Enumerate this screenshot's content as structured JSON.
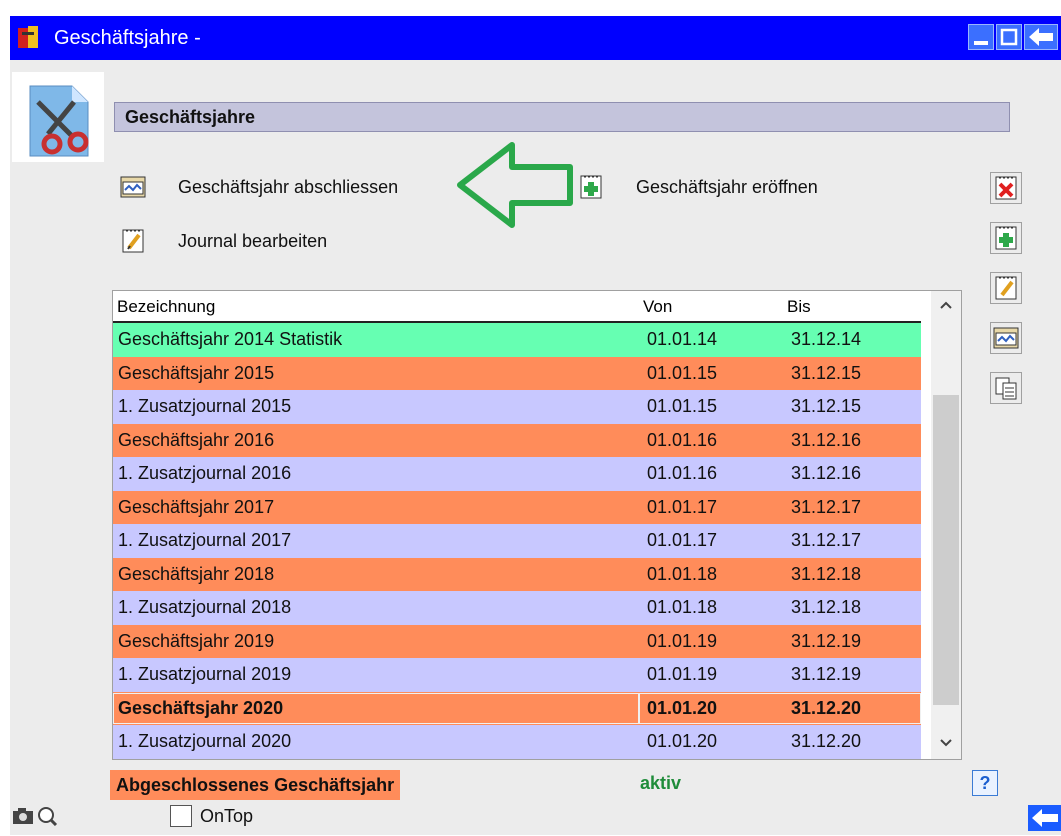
{
  "window": {
    "title": "Geschäftsjahre -"
  },
  "header": {
    "section_title": "Geschäftsjahre"
  },
  "actions": {
    "close_year": "Geschäftsjahr abschliessen",
    "open_year": "Geschäftsjahr eröffnen",
    "edit_journal": "Journal bearbeiten"
  },
  "table": {
    "columns": [
      "Bezeichnung",
      "Von",
      "Bis"
    ],
    "rows": [
      {
        "name": "Geschäftsjahr 2014 Statistik",
        "von": "01.01.14",
        "bis": "31.12.14",
        "status": "statistik"
      },
      {
        "name": "Geschäftsjahr 2015",
        "von": "01.01.15",
        "bis": "31.12.15",
        "status": "closed"
      },
      {
        "name": "1. Zusatzjournal 2015",
        "von": "01.01.15",
        "bis": "31.12.15",
        "status": "journal"
      },
      {
        "name": "Geschäftsjahr 2016",
        "von": "01.01.16",
        "bis": "31.12.16",
        "status": "closed"
      },
      {
        "name": "1. Zusatzjournal 2016",
        "von": "01.01.16",
        "bis": "31.12.16",
        "status": "journal"
      },
      {
        "name": "Geschäftsjahr 2017",
        "von": "01.01.17",
        "bis": "31.12.17",
        "status": "closed"
      },
      {
        "name": "1. Zusatzjournal 2017",
        "von": "01.01.17",
        "bis": "31.12.17",
        "status": "journal"
      },
      {
        "name": "Geschäftsjahr 2018",
        "von": "01.01.18",
        "bis": "31.12.18",
        "status": "closed"
      },
      {
        "name": "1. Zusatzjournal 2018",
        "von": "01.01.18",
        "bis": "31.12.18",
        "status": "journal"
      },
      {
        "name": "Geschäftsjahr 2019",
        "von": "01.01.19",
        "bis": "31.12.19",
        "status": "closed"
      },
      {
        "name": "1. Zusatzjournal 2019",
        "von": "01.01.19",
        "bis": "31.12.19",
        "status": "journal"
      },
      {
        "name": "Geschäftsjahr 2020",
        "von": "01.01.20",
        "bis": "31.12.20",
        "status": "selected"
      },
      {
        "name": "1. Zusatzjournal 2020",
        "von": "01.01.20",
        "bis": "31.12.20",
        "status": "journal"
      }
    ]
  },
  "legend": {
    "closed_label": "Abgeschlossenes Geschäftsjahr",
    "active_label": "aktiv"
  },
  "footer": {
    "ontop_label": "OnTop",
    "help_label": "?"
  },
  "colors": {
    "titlebar": "#0000ff",
    "closed_row": "#ff8c5a",
    "journal_row": "#c8c8ff",
    "statistik_row": "#66ffb2",
    "active_text": "#1f8c3a",
    "arrow": "#2aa84a"
  },
  "icons": {
    "app": "app-icon",
    "header": "scissors-document-icon",
    "close_year": "close-year-icon",
    "open_year": "add-document-icon",
    "edit_journal": "edit-notepad-icon",
    "delete": "delete-icon",
    "add": "add-document-icon",
    "edit": "edit-notepad-icon",
    "close": "close-year-icon",
    "copy": "copy-icon",
    "camera": "camera-icon",
    "zoom": "zoom-icon",
    "exit": "exit-arrow-icon"
  }
}
